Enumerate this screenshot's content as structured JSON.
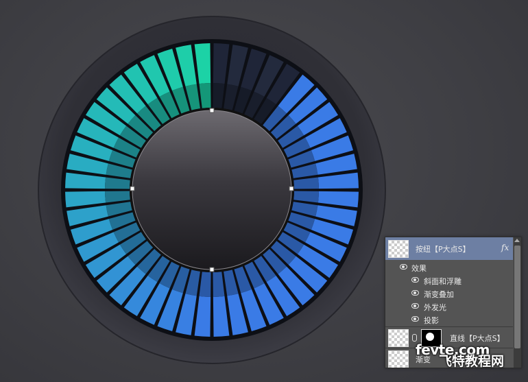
{
  "knob": {
    "segment_count": 48,
    "active_start_color": "#1bd6a3",
    "active_end_color": "#3a7be6",
    "inactive_color": "#1c2233",
    "lit_arc_fraction": 0.9,
    "center_color_top": "#6d6a70",
    "center_color_bottom": "#1b1a1e"
  },
  "layers_panel": {
    "selected_layer": {
      "name": "按纽【P大点S】",
      "fx_label": "fx"
    },
    "effects_header": "效果",
    "effects": [
      {
        "name": "斜面和浮雕"
      },
      {
        "name": "渐变叠加"
      },
      {
        "name": "外发光"
      },
      {
        "name": "投影"
      }
    ],
    "line_layer": {
      "name": "直线【P大点S】"
    },
    "gradient_layer": {
      "name": "渐变"
    }
  },
  "watermark": {
    "domain": "fevte.com",
    "chinese": "飞特教程网"
  }
}
